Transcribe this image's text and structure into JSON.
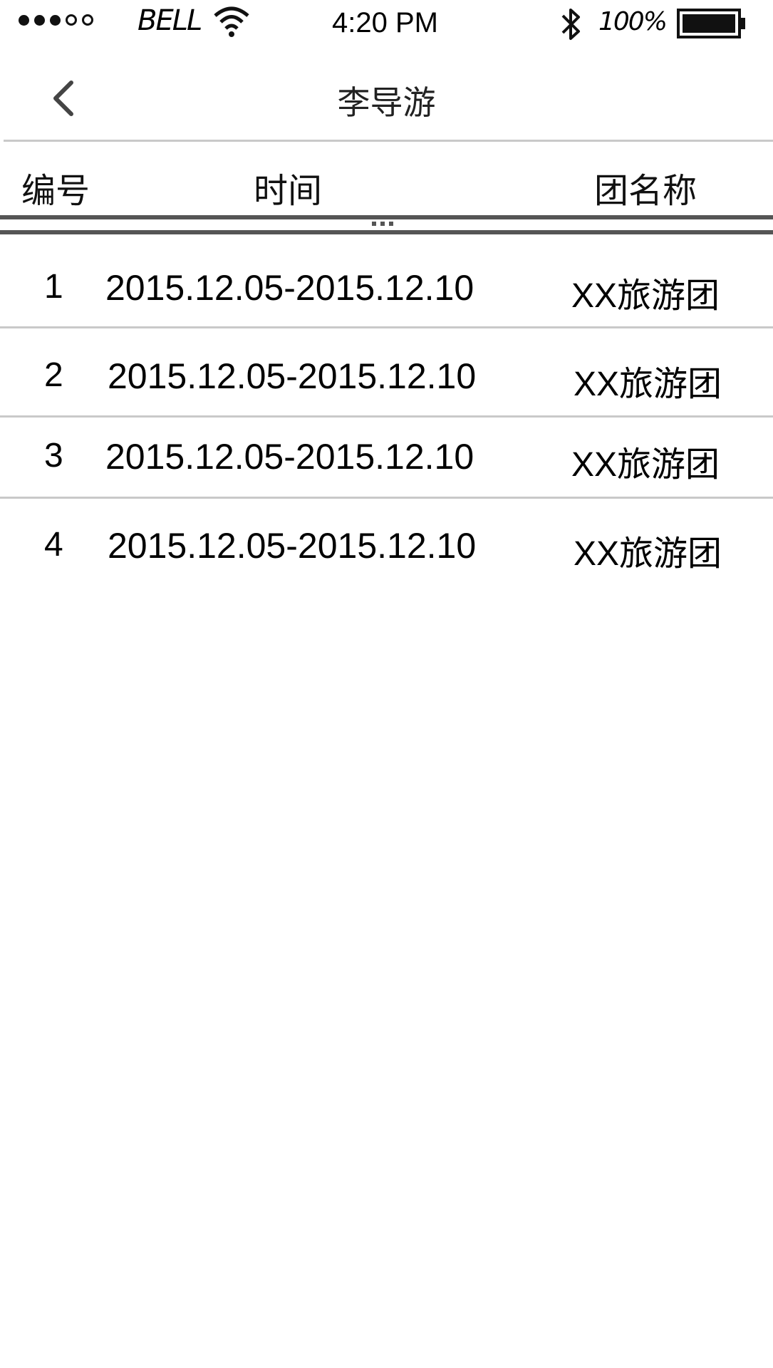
{
  "status_bar": {
    "signal_icon": "signal-dots-icon",
    "carrier": "BELL",
    "wifi_icon": "wifi-icon",
    "time": "4:20 PM",
    "bluetooth_icon": "bluetooth-icon",
    "battery_percent": "100%",
    "battery_icon": "battery-icon"
  },
  "nav": {
    "back_icon": "chevron-left-icon",
    "title": "李导游"
  },
  "table": {
    "headers": [
      "编号",
      "时间",
      "团名称"
    ],
    "rows": [
      {
        "id": "1",
        "time": "2015.12.05-2015.12.10",
        "group": "XX旅游团"
      },
      {
        "id": "2",
        "time": "2015.12.05-2015.12.10",
        "group": "XX旅游团"
      },
      {
        "id": "3",
        "time": "2015.12.05-2015.12.10",
        "group": "XX旅游团"
      },
      {
        "id": "4",
        "time": "2015.12.05-2015.12.10",
        "group": "XX旅游团"
      }
    ]
  }
}
